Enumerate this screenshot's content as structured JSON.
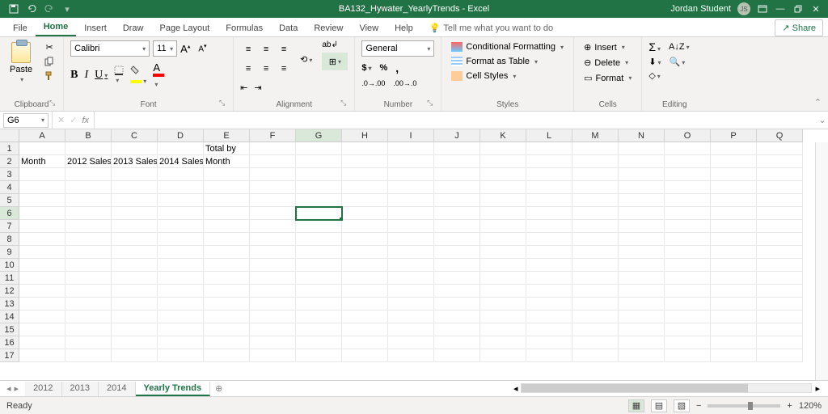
{
  "titlebar": {
    "filename": "BA132_Hywater_YearlyTrends - Excel",
    "username": "Jordan Student"
  },
  "menutabs": {
    "file": "File",
    "home": "Home",
    "insert": "Insert",
    "draw": "Draw",
    "pagelayout": "Page Layout",
    "formulas": "Formulas",
    "data": "Data",
    "review": "Review",
    "view": "View",
    "help": "Help",
    "tellme": "Tell me what you want to do",
    "share": "Share"
  },
  "ribbon": {
    "clipboard": {
      "paste": "Paste",
      "label": "Clipboard"
    },
    "font": {
      "name": "Calibri",
      "size": "11",
      "label": "Font"
    },
    "alignment": {
      "label": "Alignment"
    },
    "number": {
      "format": "General",
      "label": "Number"
    },
    "styles": {
      "conditional": "Conditional Formatting",
      "table": "Format as Table",
      "cellstyles": "Cell Styles",
      "label": "Styles"
    },
    "cells": {
      "insert": "Insert",
      "delete": "Delete",
      "format": "Format",
      "label": "Cells"
    },
    "editing": {
      "label": "Editing"
    }
  },
  "fbar": {
    "namebox": "G6",
    "fx": "fx"
  },
  "columns": [
    "A",
    "B",
    "C",
    "D",
    "E",
    "F",
    "G",
    "H",
    "I",
    "J",
    "K",
    "L",
    "M",
    "N",
    "O",
    "P",
    "Q"
  ],
  "rows": [
    "1",
    "2",
    "3",
    "4",
    "5",
    "6",
    "7",
    "8",
    "9",
    "10",
    "11",
    "12",
    "13",
    "14",
    "15",
    "16",
    "17"
  ],
  "selected": {
    "col": "G",
    "row": "6"
  },
  "cells_data": {
    "E1": "Total by",
    "A2": "Month",
    "B2": "2012 Sales",
    "C2": "2013 Sales",
    "D2": "2014 Sales",
    "E2": "Month"
  },
  "sheets": {
    "tabs": [
      "2012",
      "2013",
      "2014",
      "Yearly Trends"
    ],
    "active": "Yearly Trends"
  },
  "statusbar": {
    "ready": "Ready",
    "zoom": "120%"
  }
}
